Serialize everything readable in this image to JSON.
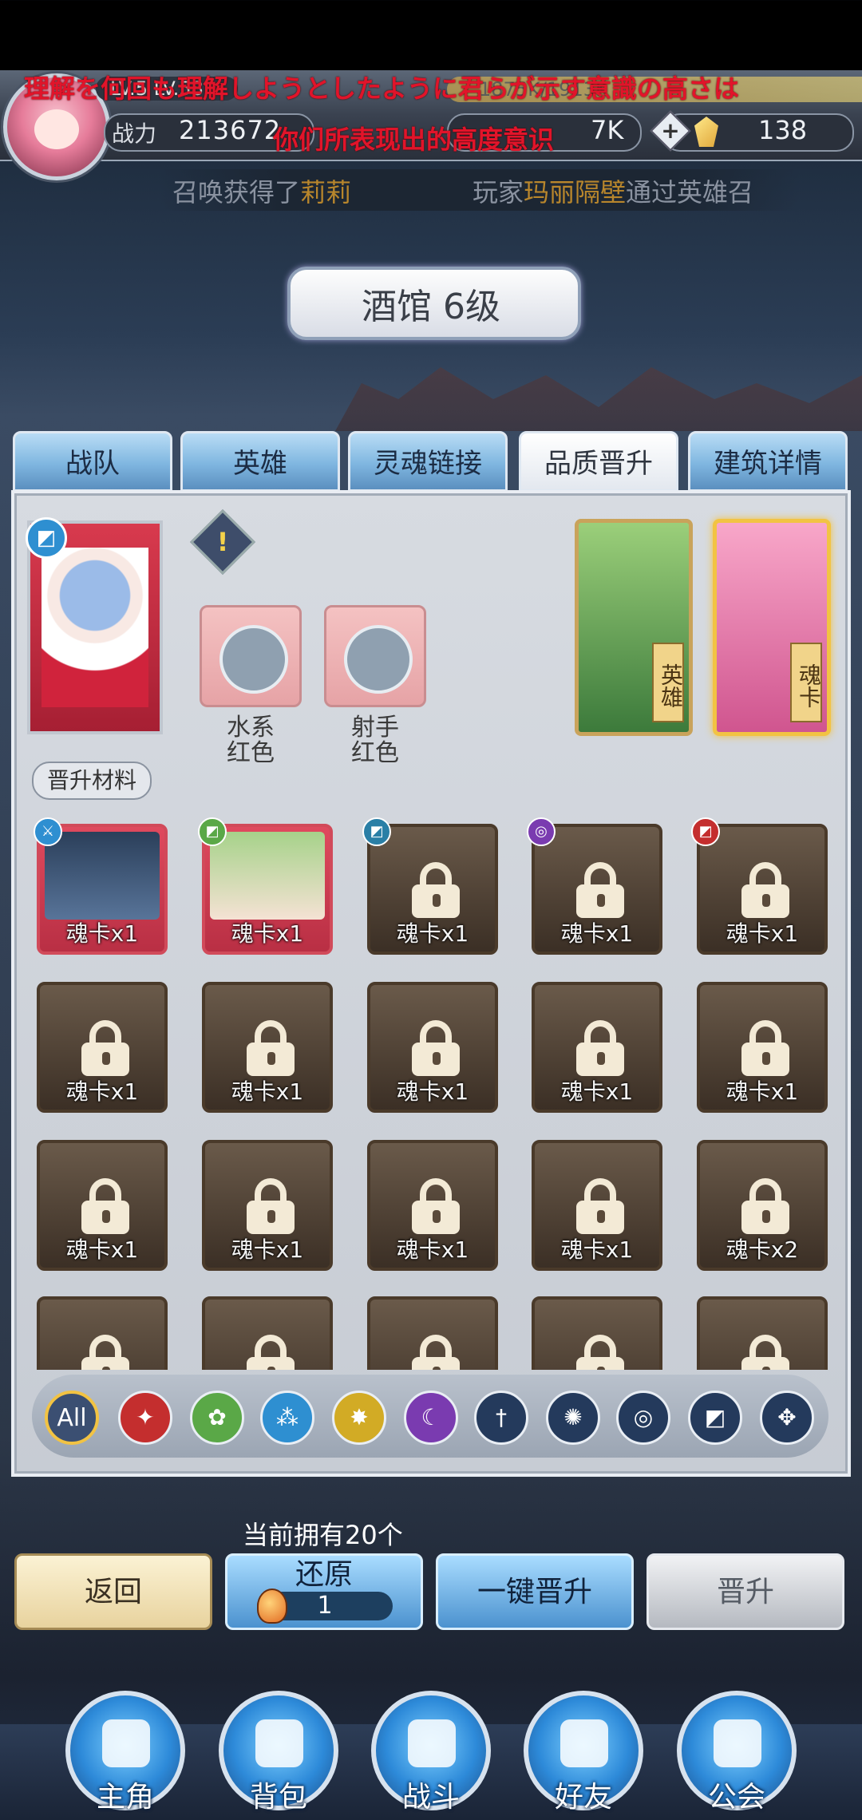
{
  "header": {
    "level_text": "LV.5 LV.58",
    "exp_text": "1875K/1913K",
    "power_label": "战力",
    "power_value": "213672",
    "resource2_value": "7K",
    "resource3_plus": "+",
    "resource3_value": "138"
  },
  "subtitles": {
    "jp": "理解を何回も理解しようとしたように君らが示す意識の高さは",
    "cn": "你们所表现出的高度意识"
  },
  "ticker": {
    "msg1_prefix": "召唤获得了",
    "msg1_name": "莉莉",
    "msg2_prefix": "玩家",
    "msg2_name": "玛丽隔壁",
    "msg2_suffix": "通过英雄召"
  },
  "tavern": {
    "title": "酒馆 6级"
  },
  "tabs": [
    "战队",
    "英雄",
    "灵魂链接",
    "品质晋升",
    "建筑详情"
  ],
  "requirements": [
    {
      "label": "水系\n红色",
      "icon": "water-element-icon"
    },
    {
      "label": "射手\n红色",
      "icon": "archer-class-icon"
    }
  ],
  "side_cards": {
    "hero_tag": "英雄",
    "soul_tag": "魂卡"
  },
  "materials_label": "晋升材料",
  "materials": [
    [
      "魂卡x1",
      "魂卡x1",
      "魂卡x1",
      "魂卡x1",
      "魂卡x1"
    ],
    [
      "魂卡x1",
      "魂卡x1",
      "魂卡x1",
      "魂卡x1",
      "魂卡x1"
    ],
    [
      "魂卡x1",
      "魂卡x1",
      "魂卡x1",
      "魂卡x1",
      "魂卡x2"
    ],
    [
      "",
      "",
      "",
      "",
      ""
    ]
  ],
  "filters": [
    "All",
    "",
    "",
    "",
    "",
    "",
    "",
    "",
    "",
    "",
    ""
  ],
  "owned_text": "当前拥有20个",
  "buttons": {
    "back": "返回",
    "restore": "还原",
    "restore_count": "1",
    "one_key": "一键晋升",
    "promote": "晋升"
  },
  "nav": [
    "主角",
    "背包",
    "战斗",
    "好友",
    "公会"
  ],
  "colors": {
    "accent_gold": "#f2c343",
    "subtitle_red": "#e1142a",
    "tab_blue": "#7fb6e0"
  }
}
